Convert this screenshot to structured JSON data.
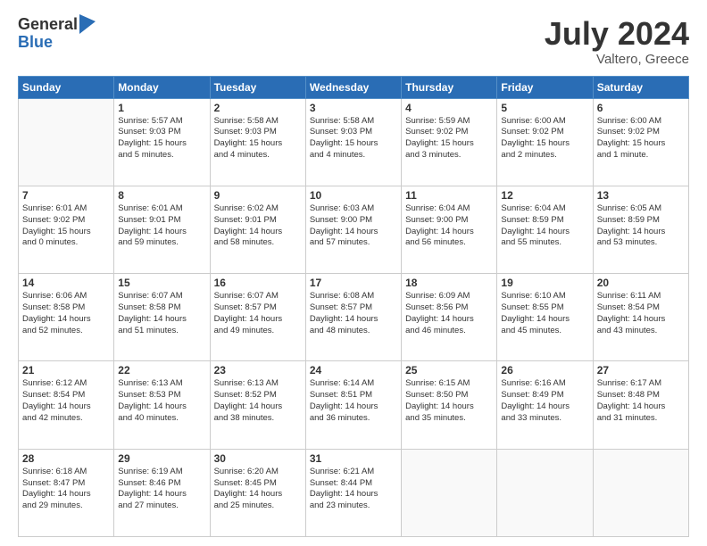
{
  "header": {
    "logo_general": "General",
    "logo_blue": "Blue",
    "month_title": "July 2024",
    "location": "Valtero, Greece"
  },
  "days_of_week": [
    "Sunday",
    "Monday",
    "Tuesday",
    "Wednesday",
    "Thursday",
    "Friday",
    "Saturday"
  ],
  "weeks": [
    [
      {
        "day": "",
        "info": ""
      },
      {
        "day": "1",
        "info": "Sunrise: 5:57 AM\nSunset: 9:03 PM\nDaylight: 15 hours\nand 5 minutes."
      },
      {
        "day": "2",
        "info": "Sunrise: 5:58 AM\nSunset: 9:03 PM\nDaylight: 15 hours\nand 4 minutes."
      },
      {
        "day": "3",
        "info": "Sunrise: 5:58 AM\nSunset: 9:03 PM\nDaylight: 15 hours\nand 4 minutes."
      },
      {
        "day": "4",
        "info": "Sunrise: 5:59 AM\nSunset: 9:02 PM\nDaylight: 15 hours\nand 3 minutes."
      },
      {
        "day": "5",
        "info": "Sunrise: 6:00 AM\nSunset: 9:02 PM\nDaylight: 15 hours\nand 2 minutes."
      },
      {
        "day": "6",
        "info": "Sunrise: 6:00 AM\nSunset: 9:02 PM\nDaylight: 15 hours\nand 1 minute."
      }
    ],
    [
      {
        "day": "7",
        "info": "Sunrise: 6:01 AM\nSunset: 9:02 PM\nDaylight: 15 hours\nand 0 minutes."
      },
      {
        "day": "8",
        "info": "Sunrise: 6:01 AM\nSunset: 9:01 PM\nDaylight: 14 hours\nand 59 minutes."
      },
      {
        "day": "9",
        "info": "Sunrise: 6:02 AM\nSunset: 9:01 PM\nDaylight: 14 hours\nand 58 minutes."
      },
      {
        "day": "10",
        "info": "Sunrise: 6:03 AM\nSunset: 9:00 PM\nDaylight: 14 hours\nand 57 minutes."
      },
      {
        "day": "11",
        "info": "Sunrise: 6:04 AM\nSunset: 9:00 PM\nDaylight: 14 hours\nand 56 minutes."
      },
      {
        "day": "12",
        "info": "Sunrise: 6:04 AM\nSunset: 8:59 PM\nDaylight: 14 hours\nand 55 minutes."
      },
      {
        "day": "13",
        "info": "Sunrise: 6:05 AM\nSunset: 8:59 PM\nDaylight: 14 hours\nand 53 minutes."
      }
    ],
    [
      {
        "day": "14",
        "info": "Sunrise: 6:06 AM\nSunset: 8:58 PM\nDaylight: 14 hours\nand 52 minutes."
      },
      {
        "day": "15",
        "info": "Sunrise: 6:07 AM\nSunset: 8:58 PM\nDaylight: 14 hours\nand 51 minutes."
      },
      {
        "day": "16",
        "info": "Sunrise: 6:07 AM\nSunset: 8:57 PM\nDaylight: 14 hours\nand 49 minutes."
      },
      {
        "day": "17",
        "info": "Sunrise: 6:08 AM\nSunset: 8:57 PM\nDaylight: 14 hours\nand 48 minutes."
      },
      {
        "day": "18",
        "info": "Sunrise: 6:09 AM\nSunset: 8:56 PM\nDaylight: 14 hours\nand 46 minutes."
      },
      {
        "day": "19",
        "info": "Sunrise: 6:10 AM\nSunset: 8:55 PM\nDaylight: 14 hours\nand 45 minutes."
      },
      {
        "day": "20",
        "info": "Sunrise: 6:11 AM\nSunset: 8:54 PM\nDaylight: 14 hours\nand 43 minutes."
      }
    ],
    [
      {
        "day": "21",
        "info": "Sunrise: 6:12 AM\nSunset: 8:54 PM\nDaylight: 14 hours\nand 42 minutes."
      },
      {
        "day": "22",
        "info": "Sunrise: 6:13 AM\nSunset: 8:53 PM\nDaylight: 14 hours\nand 40 minutes."
      },
      {
        "day": "23",
        "info": "Sunrise: 6:13 AM\nSunset: 8:52 PM\nDaylight: 14 hours\nand 38 minutes."
      },
      {
        "day": "24",
        "info": "Sunrise: 6:14 AM\nSunset: 8:51 PM\nDaylight: 14 hours\nand 36 minutes."
      },
      {
        "day": "25",
        "info": "Sunrise: 6:15 AM\nSunset: 8:50 PM\nDaylight: 14 hours\nand 35 minutes."
      },
      {
        "day": "26",
        "info": "Sunrise: 6:16 AM\nSunset: 8:49 PM\nDaylight: 14 hours\nand 33 minutes."
      },
      {
        "day": "27",
        "info": "Sunrise: 6:17 AM\nSunset: 8:48 PM\nDaylight: 14 hours\nand 31 minutes."
      }
    ],
    [
      {
        "day": "28",
        "info": "Sunrise: 6:18 AM\nSunset: 8:47 PM\nDaylight: 14 hours\nand 29 minutes."
      },
      {
        "day": "29",
        "info": "Sunrise: 6:19 AM\nSunset: 8:46 PM\nDaylight: 14 hours\nand 27 minutes."
      },
      {
        "day": "30",
        "info": "Sunrise: 6:20 AM\nSunset: 8:45 PM\nDaylight: 14 hours\nand 25 minutes."
      },
      {
        "day": "31",
        "info": "Sunrise: 6:21 AM\nSunset: 8:44 PM\nDaylight: 14 hours\nand 23 minutes."
      },
      {
        "day": "",
        "info": ""
      },
      {
        "day": "",
        "info": ""
      },
      {
        "day": "",
        "info": ""
      }
    ]
  ]
}
